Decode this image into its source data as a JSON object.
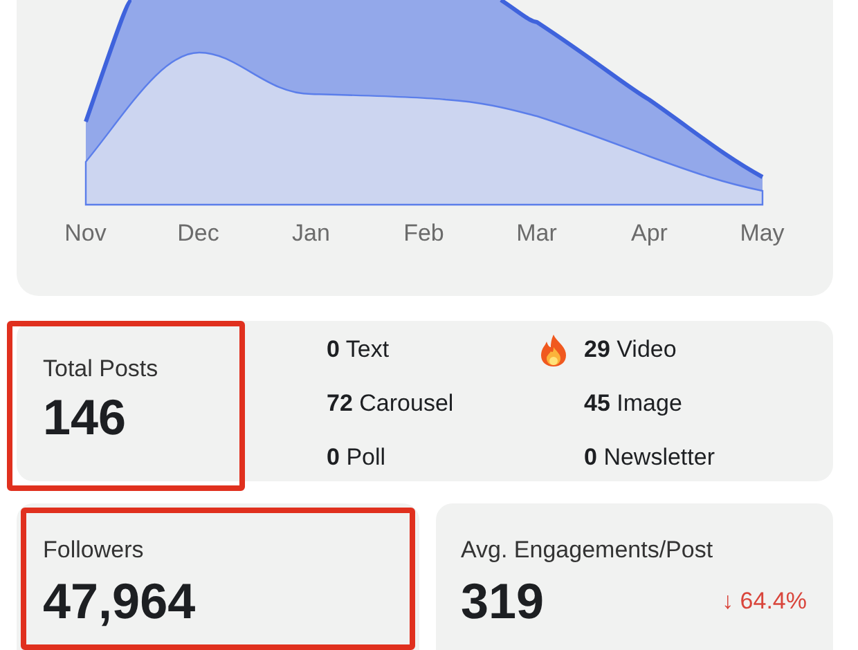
{
  "chart": {
    "months": [
      "Nov",
      "Dec",
      "Jan",
      "Feb",
      "Mar",
      "Apr",
      "May"
    ]
  },
  "total_posts": {
    "label": "Total Posts",
    "value": "146",
    "highlighted": true,
    "breakdown": [
      {
        "count": "0",
        "label": "Text",
        "hot": false
      },
      {
        "count": "29",
        "label": "Video",
        "hot": true
      },
      {
        "count": "72",
        "label": "Carousel",
        "hot": false
      },
      {
        "count": "45",
        "label": "Image",
        "hot": false
      },
      {
        "count": "0",
        "label": "Poll",
        "hot": false
      },
      {
        "count": "0",
        "label": "Newsletter",
        "hot": false
      }
    ]
  },
  "followers": {
    "label": "Followers",
    "value": "47,964",
    "highlighted": true
  },
  "engagements": {
    "label": "Avg. Engagements/Post",
    "value": "319",
    "change": "↓ 64.4%"
  }
}
